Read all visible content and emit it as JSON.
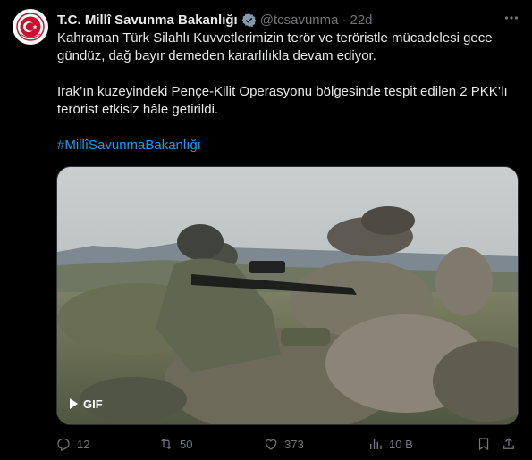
{
  "tweet": {
    "author_name": "T.C. Millî Savunma Bakanlığı",
    "handle": "@tcsavunma",
    "separator": "·",
    "time": "22d",
    "paragraph1": "Kahraman Türk Silahlı Kuvvetlerimizin terör ve teröristle mücadelesi gece gündüz, dağ bayır demeden kararlılıkla devam ediyor.",
    "paragraph2": "Irak’ın kuzeyindeki Pençe-Kilit Operasyonu bölgesinde tespit edilen 2 PKK’lı terörist etkisiz hâle getirildi.",
    "hashtag": "#MillîSavunmaBakanlığı"
  },
  "media": {
    "badge": "GIF"
  },
  "actions": {
    "replies": "12",
    "retweets": "50",
    "likes": "373",
    "views": "10 B"
  },
  "colors": {
    "background": "#000000",
    "text": "#e7e9ea",
    "muted": "#71767b",
    "link": "#1d9bf0",
    "verified_gold": "#e2b719",
    "avatar_red": "#c8102e"
  },
  "icons": {
    "verified": "verified-badge-icon",
    "more": "more-dots-icon",
    "reply": "reply-icon",
    "retweet": "retweet-icon",
    "like": "heart-icon",
    "views": "views-chart-icon",
    "bookmark": "bookmark-icon",
    "share": "share-icon"
  }
}
